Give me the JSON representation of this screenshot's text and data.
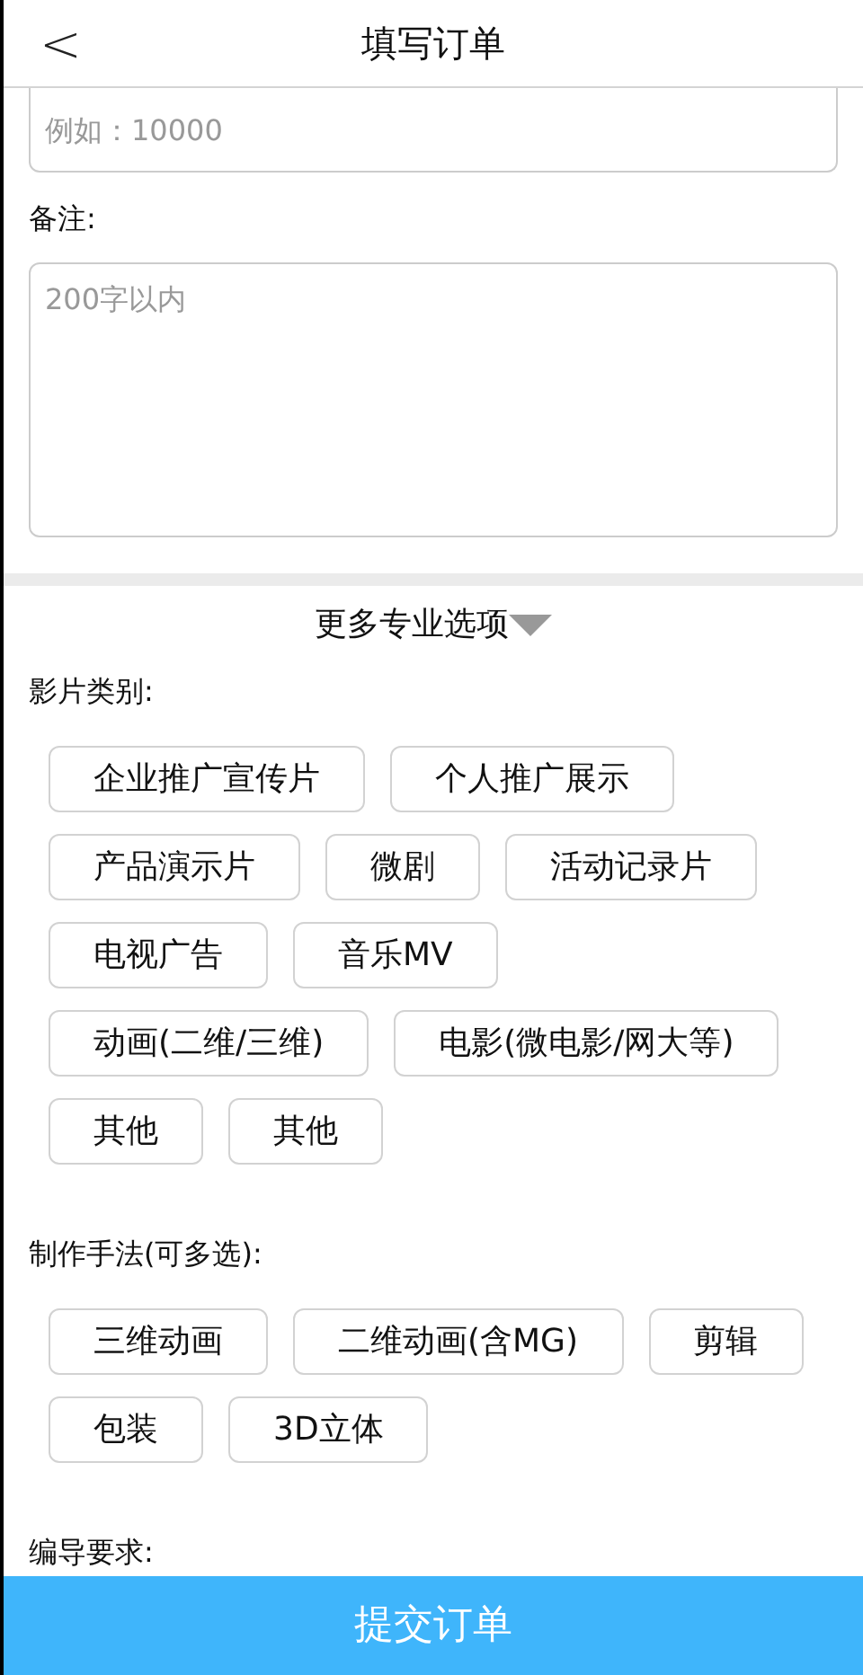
{
  "header": {
    "back": "<",
    "title": "填写订单"
  },
  "amount_field": {
    "placeholder": "例如：10000"
  },
  "remark": {
    "label": "备注:",
    "placeholder": "200字以内"
  },
  "more_options": {
    "label": "更多专业选项",
    "expanded": true
  },
  "sections": [
    {
      "label": "影片类别:",
      "tags": [
        "企业推广宣传片",
        "个人推广展示",
        "产品演示片",
        "微剧",
        "活动记录片",
        "电视广告",
        "音乐MV",
        "动画(二维/三维)",
        "电影(微电影/网大等)",
        "其他",
        "其他"
      ]
    },
    {
      "label": "制作手法(可多选):",
      "tags": [
        "三维动画",
        "二维动画(含MG)",
        "剪辑",
        "包装",
        "3D立体"
      ]
    },
    {
      "label": "编导要求:"
    }
  ],
  "submit_button": "提交订单"
}
